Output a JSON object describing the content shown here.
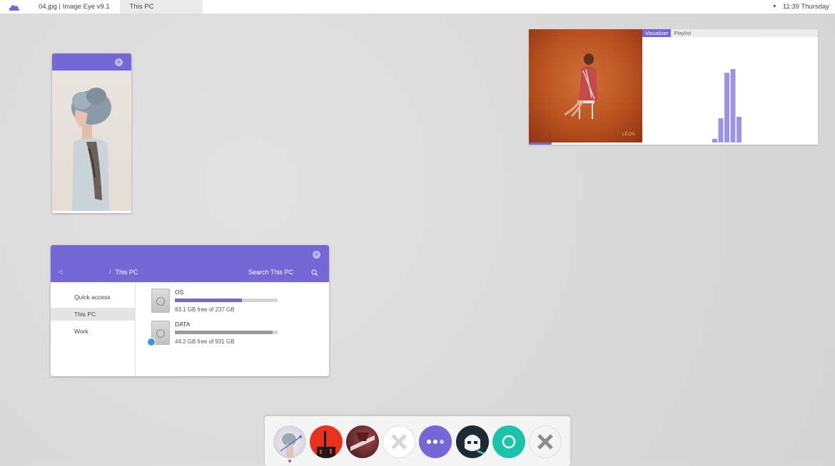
{
  "topbar": {
    "logo_icon": "cloud-icon",
    "tabs": [
      {
        "label": "04.jpg | Image Eye v9.1",
        "active": false
      },
      {
        "label": "This PC",
        "active": true
      }
    ],
    "clock": "11:39 Thursday"
  },
  "image_viewer": {
    "close_icon": "close-icon"
  },
  "music": {
    "cover_label": "LÉON",
    "tabs": [
      {
        "label": "Visualizer",
        "active": true
      },
      {
        "label": "Playlist",
        "active": false
      }
    ],
    "progress": 0.08,
    "visualizer_levels": [
      0.05,
      0.33,
      0.95,
      1.0,
      0.35
    ]
  },
  "explorer": {
    "back_icon": "back-arrow-icon",
    "breadcrumb_sep": "/",
    "breadcrumb": "This PC",
    "search_label": "Search This PC",
    "sidebar": [
      {
        "label": "Quick access",
        "selected": false
      },
      {
        "label": "This PC",
        "selected": true
      },
      {
        "label": "Work",
        "selected": false
      }
    ],
    "drives": [
      {
        "name": "OS",
        "free_text": "83.1 GB free of 237 GB",
        "used_fraction": 0.65,
        "bar_color": "#7568d6"
      },
      {
        "name": "DATA",
        "free_text": "44.2 GB free of 931 GB",
        "used_fraction": 0.953,
        "bar_color": "#9a9a9a"
      }
    ]
  },
  "dock": {
    "apps": [
      {
        "name": "image-eye-app-icon"
      },
      {
        "name": "red-poster-app-icon"
      },
      {
        "name": "dark-red-app-icon"
      },
      {
        "name": "x-app-icon"
      },
      {
        "name": "more-app-icon"
      },
      {
        "name": "stormtrooper-app-icon"
      },
      {
        "name": "teal-circle-app-icon"
      },
      {
        "name": "gray-x-app-icon"
      }
    ]
  },
  "colors": {
    "accent": "#7568d6"
  }
}
